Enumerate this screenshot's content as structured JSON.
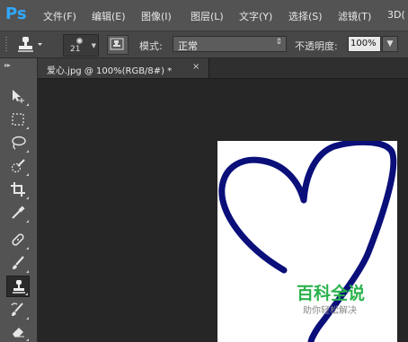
{
  "app": {
    "logo": "Ps"
  },
  "menu": [
    "文件(F)",
    "编辑(E)",
    "图像(I)",
    "图层(L)",
    "文字(Y)",
    "选择(S)",
    "滤镜(T)",
    "3D("
  ],
  "options": {
    "brush_size": "21",
    "mode_label": "模式:",
    "mode_value": "正常",
    "opacity_label": "不透明度:",
    "opacity_value": "100%"
  },
  "document": {
    "tab_title": "爱心.jpg @ 100%(RGB/8#) *",
    "close_glyph": "×"
  },
  "watermark": {
    "title": "百科全说",
    "subtitle": "助你轻松解决"
  },
  "colors": {
    "heart_stroke": "#0a0f7a",
    "ps_blue": "#31a8ff",
    "watermark_green": "#2bb24c"
  },
  "tools": [
    "move-icon",
    "marquee-icon",
    "lasso-icon",
    "quick-selection-icon",
    "crop-icon",
    "eyedropper-icon",
    "spot-healing-icon",
    "brush-icon",
    "clone-stamp-icon",
    "history-brush-icon",
    "eraser-icon"
  ]
}
